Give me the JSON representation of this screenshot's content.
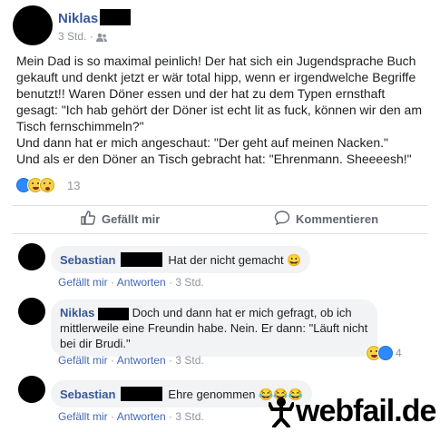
{
  "post": {
    "author": "Niklas",
    "time": "3 Std. ·",
    "text": "Mein Dad is so maximal peinlich! Der hat sich ein Jugendsprache Buch gekauft und denkt jetzt er wär total hipp, wenn er irgendwelche Begriffe benutzt!! Waren Döner essen und der hat zu dem Typen ernsthaft gesagt: \"Ich hab gehört der Döner ist echt lit as fuck, können wir den am Tisch fernschimmeln?\"\nUnd dann hat er mich angeschaut: \"Der geht auf meinen Nacken.\"\nUnd als er den Döner an Tisch gebracht hat: \"Ehrenmann. Sheeeesh!\"",
    "reaction_count": "13",
    "like_label": "Gefällt mir",
    "comment_label": "Kommentieren"
  },
  "comments": [
    {
      "author": "Sebastian",
      "text": "Hat der nicht gemacht 😀",
      "like": "Gefällt mir",
      "reply": "Antworten",
      "time": "3 Std."
    },
    {
      "author": "Niklas",
      "text": "Doch und dann hat er mich gefragt, ob ich mittlerweile eine Freundin habe. Nein. Er dann: \"Läuft nicht bei dir Brudi.\"",
      "like": "Gefällt mir",
      "reply": "Antworten",
      "time": "3 Std.",
      "reaction_count": "4"
    },
    {
      "author": "Sebastian",
      "text": "Ehre genommen 😂😂😂",
      "like": "Gefällt mir",
      "reply": "Antworten",
      "time": "3 Std."
    }
  ],
  "watermark": "webfail.de"
}
